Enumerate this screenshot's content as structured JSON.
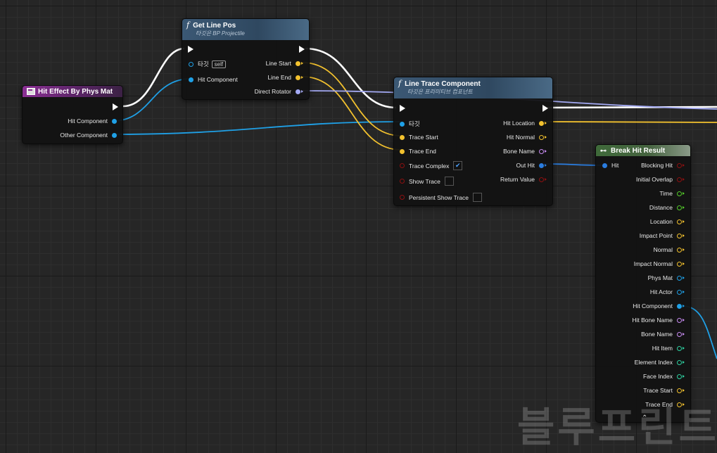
{
  "colors": {
    "exec": "#ffffff",
    "object": "#1fa0e6",
    "vector": "#f2c12e",
    "rotator": "#a3a9f3",
    "boolean": "#8e1010",
    "float": "#54cc2a",
    "name": "#c88cf2",
    "integer": "#2ed1a1",
    "struct": "#2a7de0"
  },
  "hit_effect_node": {
    "title": "Hit Effect By Phys Mat",
    "pins": [
      "Hit Component",
      "Other Component"
    ]
  },
  "get_line_pos_node": {
    "title": "Get Line Pos",
    "subtitle": "타깃은 BP Projectile",
    "target_label": "타깃",
    "target_default": "self",
    "inputs": [
      "Hit Component"
    ],
    "outputs": [
      "Line Start",
      "Line End",
      "Direct Rotator"
    ]
  },
  "line_trace_node": {
    "title": "Line Trace Component",
    "subtitle": "타깃은 프리미티브 컴포넌트",
    "inputs": [
      "타깃",
      "Trace Start",
      "Trace End",
      "Trace Complex",
      "Show Trace",
      "Persistent Show Trace"
    ],
    "trace_complex_checked": true,
    "show_trace_checked": false,
    "persistent_show_trace_checked": false,
    "outputs": [
      "Hit Location",
      "Hit Normal",
      "Bone Name",
      "Out Hit",
      "Return Value"
    ]
  },
  "break_hit_node": {
    "title": "Break Hit Result",
    "input": "Hit",
    "outputs": [
      "Blocking Hit",
      "Initial Overlap",
      "Time",
      "Distance",
      "Location",
      "Impact Point",
      "Normal",
      "Impact Normal",
      "Phys Mat",
      "Hit Actor",
      "Hit Component",
      "Hit Bone Name",
      "Bone Name",
      "Hit Item",
      "Element Index",
      "Face Index",
      "Trace Start",
      "Trace End"
    ]
  },
  "watermark": "블루프린트"
}
